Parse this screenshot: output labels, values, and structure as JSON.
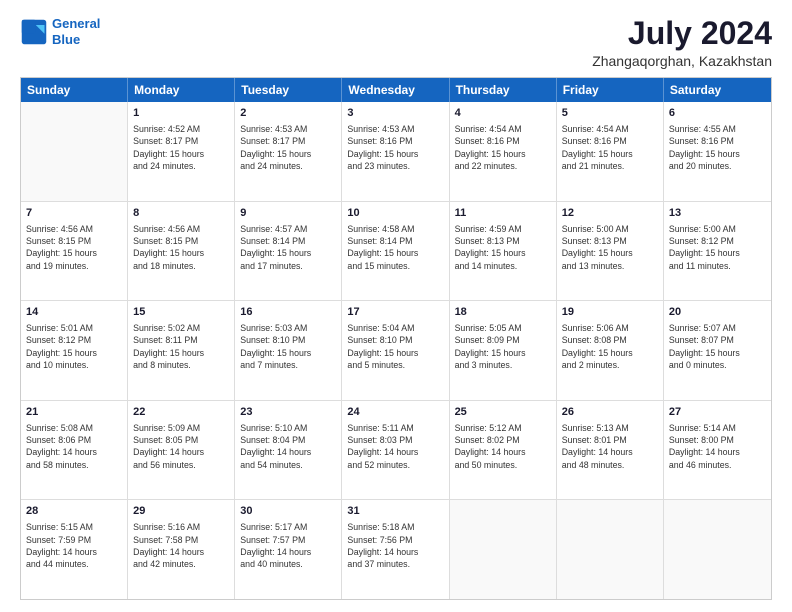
{
  "logo": {
    "line1": "General",
    "line2": "Blue"
  },
  "header": {
    "month_year": "July 2024",
    "location": "Zhangaqorghan, Kazakhstan"
  },
  "days_of_week": [
    "Sunday",
    "Monday",
    "Tuesday",
    "Wednesday",
    "Thursday",
    "Friday",
    "Saturday"
  ],
  "weeks": [
    [
      {
        "day": "",
        "info": ""
      },
      {
        "day": "1",
        "info": "Sunrise: 4:52 AM\nSunset: 8:17 PM\nDaylight: 15 hours\nand 24 minutes."
      },
      {
        "day": "2",
        "info": "Sunrise: 4:53 AM\nSunset: 8:17 PM\nDaylight: 15 hours\nand 24 minutes."
      },
      {
        "day": "3",
        "info": "Sunrise: 4:53 AM\nSunset: 8:16 PM\nDaylight: 15 hours\nand 23 minutes."
      },
      {
        "day": "4",
        "info": "Sunrise: 4:54 AM\nSunset: 8:16 PM\nDaylight: 15 hours\nand 22 minutes."
      },
      {
        "day": "5",
        "info": "Sunrise: 4:54 AM\nSunset: 8:16 PM\nDaylight: 15 hours\nand 21 minutes."
      },
      {
        "day": "6",
        "info": "Sunrise: 4:55 AM\nSunset: 8:16 PM\nDaylight: 15 hours\nand 20 minutes."
      }
    ],
    [
      {
        "day": "7",
        "info": "Sunrise: 4:56 AM\nSunset: 8:15 PM\nDaylight: 15 hours\nand 19 minutes."
      },
      {
        "day": "8",
        "info": "Sunrise: 4:56 AM\nSunset: 8:15 PM\nDaylight: 15 hours\nand 18 minutes."
      },
      {
        "day": "9",
        "info": "Sunrise: 4:57 AM\nSunset: 8:14 PM\nDaylight: 15 hours\nand 17 minutes."
      },
      {
        "day": "10",
        "info": "Sunrise: 4:58 AM\nSunset: 8:14 PM\nDaylight: 15 hours\nand 15 minutes."
      },
      {
        "day": "11",
        "info": "Sunrise: 4:59 AM\nSunset: 8:13 PM\nDaylight: 15 hours\nand 14 minutes."
      },
      {
        "day": "12",
        "info": "Sunrise: 5:00 AM\nSunset: 8:13 PM\nDaylight: 15 hours\nand 13 minutes."
      },
      {
        "day": "13",
        "info": "Sunrise: 5:00 AM\nSunset: 8:12 PM\nDaylight: 15 hours\nand 11 minutes."
      }
    ],
    [
      {
        "day": "14",
        "info": "Sunrise: 5:01 AM\nSunset: 8:12 PM\nDaylight: 15 hours\nand 10 minutes."
      },
      {
        "day": "15",
        "info": "Sunrise: 5:02 AM\nSunset: 8:11 PM\nDaylight: 15 hours\nand 8 minutes."
      },
      {
        "day": "16",
        "info": "Sunrise: 5:03 AM\nSunset: 8:10 PM\nDaylight: 15 hours\nand 7 minutes."
      },
      {
        "day": "17",
        "info": "Sunrise: 5:04 AM\nSunset: 8:10 PM\nDaylight: 15 hours\nand 5 minutes."
      },
      {
        "day": "18",
        "info": "Sunrise: 5:05 AM\nSunset: 8:09 PM\nDaylight: 15 hours\nand 3 minutes."
      },
      {
        "day": "19",
        "info": "Sunrise: 5:06 AM\nSunset: 8:08 PM\nDaylight: 15 hours\nand 2 minutes."
      },
      {
        "day": "20",
        "info": "Sunrise: 5:07 AM\nSunset: 8:07 PM\nDaylight: 15 hours\nand 0 minutes."
      }
    ],
    [
      {
        "day": "21",
        "info": "Sunrise: 5:08 AM\nSunset: 8:06 PM\nDaylight: 14 hours\nand 58 minutes."
      },
      {
        "day": "22",
        "info": "Sunrise: 5:09 AM\nSunset: 8:05 PM\nDaylight: 14 hours\nand 56 minutes."
      },
      {
        "day": "23",
        "info": "Sunrise: 5:10 AM\nSunset: 8:04 PM\nDaylight: 14 hours\nand 54 minutes."
      },
      {
        "day": "24",
        "info": "Sunrise: 5:11 AM\nSunset: 8:03 PM\nDaylight: 14 hours\nand 52 minutes."
      },
      {
        "day": "25",
        "info": "Sunrise: 5:12 AM\nSunset: 8:02 PM\nDaylight: 14 hours\nand 50 minutes."
      },
      {
        "day": "26",
        "info": "Sunrise: 5:13 AM\nSunset: 8:01 PM\nDaylight: 14 hours\nand 48 minutes."
      },
      {
        "day": "27",
        "info": "Sunrise: 5:14 AM\nSunset: 8:00 PM\nDaylight: 14 hours\nand 46 minutes."
      }
    ],
    [
      {
        "day": "28",
        "info": "Sunrise: 5:15 AM\nSunset: 7:59 PM\nDaylight: 14 hours\nand 44 minutes."
      },
      {
        "day": "29",
        "info": "Sunrise: 5:16 AM\nSunset: 7:58 PM\nDaylight: 14 hours\nand 42 minutes."
      },
      {
        "day": "30",
        "info": "Sunrise: 5:17 AM\nSunset: 7:57 PM\nDaylight: 14 hours\nand 40 minutes."
      },
      {
        "day": "31",
        "info": "Sunrise: 5:18 AM\nSunset: 7:56 PM\nDaylight: 14 hours\nand 37 minutes."
      },
      {
        "day": "",
        "info": ""
      },
      {
        "day": "",
        "info": ""
      },
      {
        "day": "",
        "info": ""
      }
    ]
  ]
}
